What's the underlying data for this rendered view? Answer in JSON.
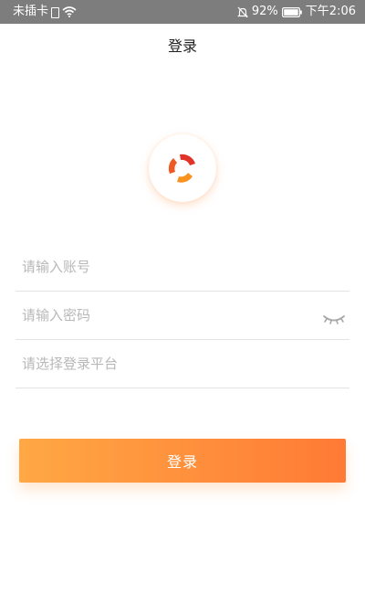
{
  "status_bar": {
    "carrier": "未插卡",
    "battery": "92%",
    "time": "下午2:06"
  },
  "header": {
    "title": "登录"
  },
  "form": {
    "account_placeholder": "请输入账号",
    "password_placeholder": "请输入密码",
    "platform_placeholder": "请选择登录平台"
  },
  "login_button": {
    "label": "登录"
  },
  "colors": {
    "accent_start": "#ffa844",
    "accent_end": "#ff7a35",
    "logo_red": "#e0332a",
    "logo_orange": "#f7931e"
  },
  "icons": {
    "sim": "sim-card-icon",
    "wifi": "wifi-icon",
    "mute": "bell-off-icon",
    "battery": "battery-icon",
    "password_toggle": "eye-closed-icon",
    "logo": "app-logo-icon"
  }
}
